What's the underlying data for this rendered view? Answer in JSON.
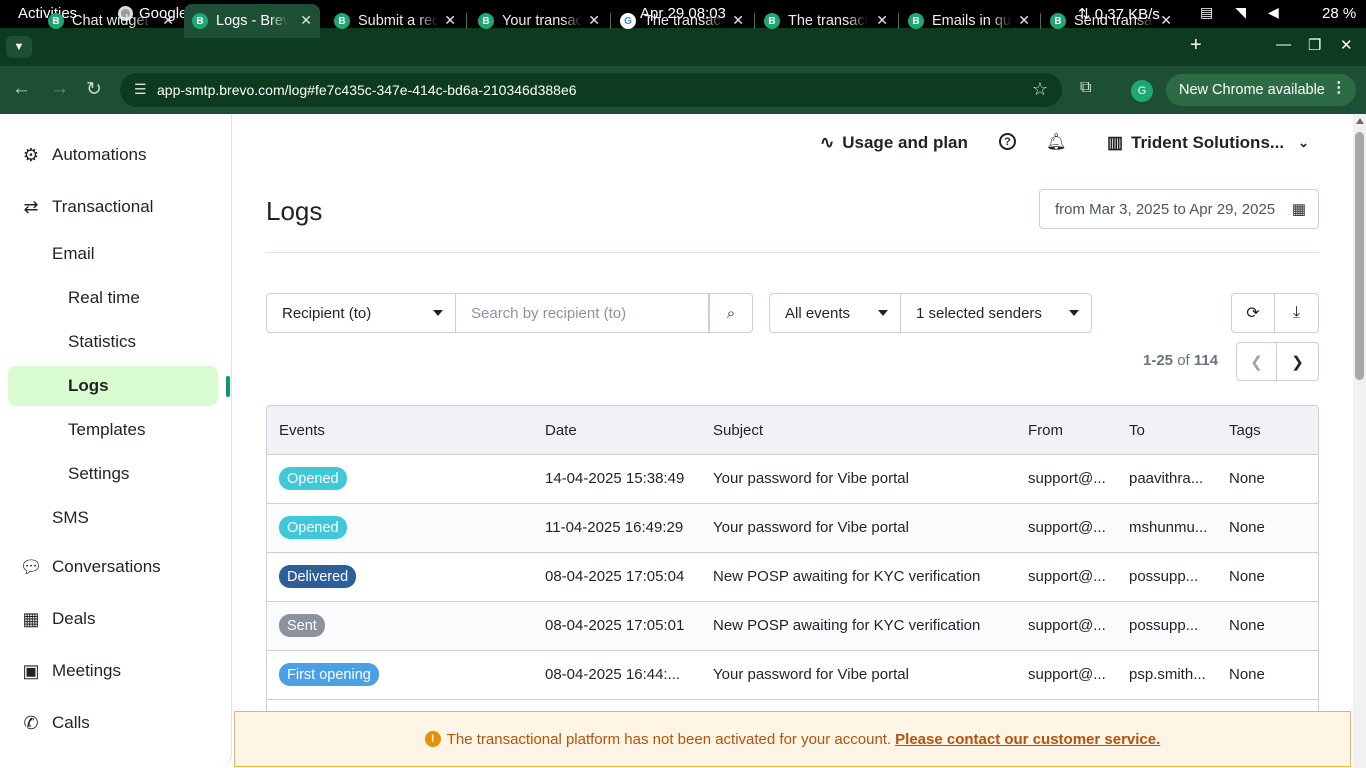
{
  "system_bar": {
    "activities": "Activities",
    "app_name": "Google Chrome",
    "datetime": "Apr 29  08:03",
    "net_speed": "⇅ 0.37 KB/s",
    "battery": "28 %"
  },
  "browser": {
    "tabs": [
      {
        "title": "Chat widget",
        "favicon": "B",
        "active": false
      },
      {
        "title": "Logs - Brevo",
        "favicon": "B",
        "active": true
      },
      {
        "title": "Submit a request",
        "favicon": "B",
        "active": false
      },
      {
        "title": "Your transactional",
        "favicon": "B",
        "active": false
      },
      {
        "title": "The transactional",
        "favicon": "G",
        "active": false
      },
      {
        "title": "The transactional",
        "favicon": "B",
        "active": false
      },
      {
        "title": "Emails in queue",
        "favicon": "B",
        "active": false
      },
      {
        "title": "Send transactional",
        "favicon": "B",
        "active": false
      }
    ],
    "url": "app-smtp.brevo.com/log#fe7c435c-347e-414c-bd6a-210346d388e6",
    "profile_initial": "G",
    "update_button": "New Chrome available"
  },
  "sidebar": {
    "automations": "Automations",
    "transactional": "Transactional",
    "email": "Email",
    "real_time": "Real time",
    "statistics": "Statistics",
    "logs": "Logs",
    "templates": "Templates",
    "settings": "Settings",
    "sms": "SMS",
    "conversations": "Conversations",
    "deals": "Deals",
    "meetings": "Meetings",
    "calls": "Calls"
  },
  "header": {
    "usage": "Usage and plan",
    "help": "?",
    "company": "Trident Solutions..."
  },
  "page": {
    "title": "Logs",
    "date_range": "from Mar 3, 2025 to Apr 29, 2025"
  },
  "filters": {
    "recipient_select": "Recipient (to)",
    "search_placeholder": "Search by recipient (to)",
    "events_select": "All events",
    "senders_select": "1 selected senders"
  },
  "pagination": {
    "range": "1-25",
    "of": "of",
    "total": "114"
  },
  "table": {
    "headers": {
      "events": "Events",
      "date": "Date",
      "subject": "Subject",
      "from": "From",
      "to": "To",
      "tags": "Tags"
    },
    "rows": [
      {
        "event": "Opened",
        "event_color": "#3ec8d8",
        "date": "14-04-2025 15:38:49",
        "subject": "Your password for Vibe portal",
        "from": "support@...",
        "to": "paavithra...",
        "tags": "None"
      },
      {
        "event": "Opened",
        "event_color": "#3ec8d8",
        "date": "11-04-2025 16:49:29",
        "subject": "Your password for Vibe portal",
        "from": "support@...",
        "to": "mshunmu...",
        "tags": "None"
      },
      {
        "event": "Delivered",
        "event_color": "#2c5f99",
        "date": "08-04-2025 17:05:04",
        "subject": "New POSP awaiting for KYC verification",
        "from": "support@...",
        "to": "possupp...",
        "tags": "None"
      },
      {
        "event": "Sent",
        "event_color": "#8a929e",
        "date": "08-04-2025 17:05:01",
        "subject": "New POSP awaiting for KYC verification",
        "from": "support@...",
        "to": "possupp...",
        "tags": "None"
      },
      {
        "event": "First opening",
        "event_color": "#4aa0e6",
        "date": "08-04-2025 16:44:...",
        "subject": "Your password for Vibe portal",
        "from": "support@...",
        "to": "psp.smith...",
        "tags": "None"
      }
    ]
  },
  "banner": {
    "message": "The transactional platform has not been activated for your account.",
    "link": "Please contact our customer service."
  }
}
